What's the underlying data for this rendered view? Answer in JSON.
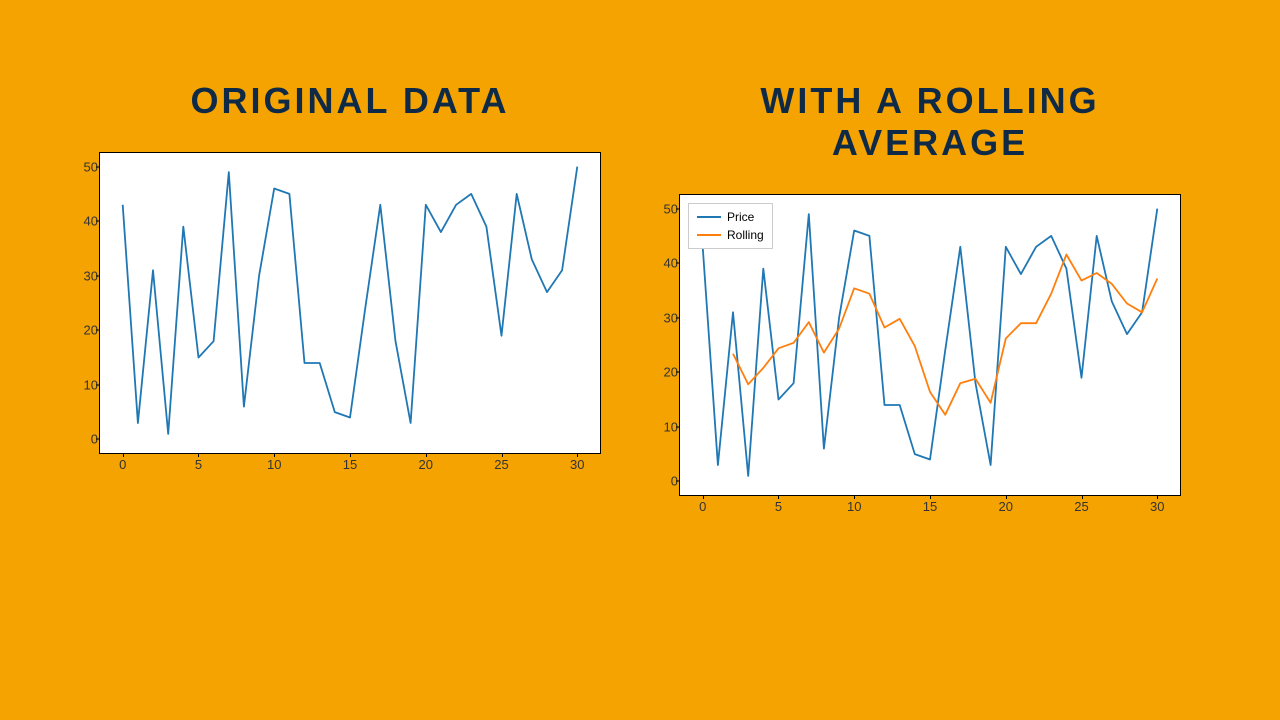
{
  "titles": {
    "left": "ORIGINAL DATA",
    "right": "WITH A ROLLING AVERAGE"
  },
  "legend": {
    "price": "Price",
    "rolling": "Rolling"
  },
  "colors": {
    "price": "#1f77b4",
    "rolling": "#ff7f0e",
    "bg": "#f5a300",
    "title": "#0e2a47"
  },
  "axes": {
    "xticks": [
      0,
      5,
      10,
      15,
      20,
      25,
      30
    ],
    "yticks": [
      0,
      10,
      20,
      30,
      40,
      50
    ],
    "xlim": [
      -1.5,
      31.5
    ],
    "ylim": [
      -2.5,
      52.5
    ]
  },
  "chart_data": [
    {
      "type": "line",
      "title": "ORIGINAL DATA",
      "xlabel": "",
      "ylabel": "",
      "x": [
        0,
        1,
        2,
        3,
        4,
        5,
        6,
        7,
        8,
        9,
        10,
        11,
        12,
        13,
        14,
        15,
        16,
        17,
        18,
        19,
        20,
        21,
        22,
        23,
        24,
        25,
        26,
        27,
        28,
        29,
        30
      ],
      "series": [
        {
          "name": "Price",
          "values": [
            43,
            3,
            31,
            1,
            39,
            15,
            18,
            49,
            6,
            30,
            46,
            45,
            14,
            14,
            5,
            4,
            24,
            43,
            18,
            3,
            43,
            38,
            43,
            45,
            39,
            19,
            45,
            33,
            27,
            31,
            50
          ]
        }
      ],
      "xlim": [
        -1.5,
        31.5
      ],
      "ylim": [
        -2.5,
        52.5
      ]
    },
    {
      "type": "line",
      "title": "WITH A ROLLING AVERAGE",
      "xlabel": "",
      "ylabel": "",
      "x": [
        0,
        1,
        2,
        3,
        4,
        5,
        6,
        7,
        8,
        9,
        10,
        11,
        12,
        13,
        14,
        15,
        16,
        17,
        18,
        19,
        20,
        21,
        22,
        23,
        24,
        25,
        26,
        27,
        28,
        29,
        30
      ],
      "series": [
        {
          "name": "Price",
          "values": [
            43,
            3,
            31,
            1,
            39,
            15,
            18,
            49,
            6,
            30,
            46,
            45,
            14,
            14,
            5,
            4,
            24,
            43,
            18,
            3,
            43,
            38,
            43,
            45,
            39,
            19,
            45,
            33,
            27,
            31,
            50
          ]
        },
        {
          "name": "Rolling",
          "values": [
            null,
            null,
            23.4,
            17.8,
            20.8,
            24.4,
            25.4,
            29.2,
            23.6,
            28.0,
            35.4,
            34.4,
            28.2,
            29.8,
            24.8,
            16.4,
            12.2,
            18.0,
            18.8,
            14.4,
            26.2,
            29.0,
            29.0,
            34.4,
            41.6,
            36.8,
            38.2,
            36.2,
            32.6,
            31.0,
            37.2
          ]
        }
      ],
      "legend_position": "upper left",
      "xlim": [
        -1.5,
        31.5
      ],
      "ylim": [
        -2.5,
        52.5
      ]
    }
  ]
}
